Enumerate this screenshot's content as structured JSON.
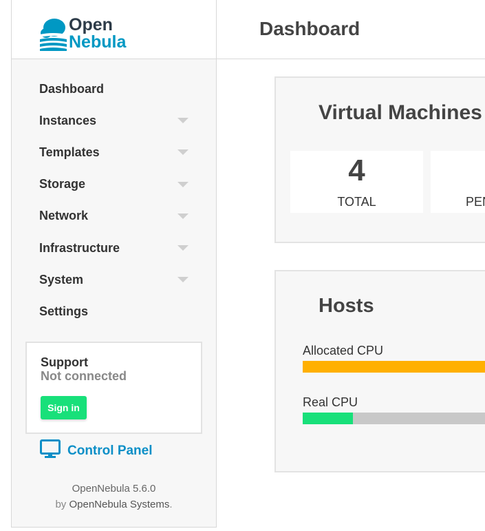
{
  "logo": {
    "line1": "Open",
    "line2": "Nebula"
  },
  "header": {
    "title": "Dashboard"
  },
  "sidebar": {
    "items": [
      {
        "label": "Dashboard",
        "has_submenu": false
      },
      {
        "label": "Instances",
        "has_submenu": true
      },
      {
        "label": "Templates",
        "has_submenu": true
      },
      {
        "label": "Storage",
        "has_submenu": true
      },
      {
        "label": "Network",
        "has_submenu": true
      },
      {
        "label": "Infrastructure",
        "has_submenu": true
      },
      {
        "label": "System",
        "has_submenu": true
      },
      {
        "label": "Settings",
        "has_submenu": false
      }
    ],
    "support": {
      "title": "Support",
      "status": "Not connected",
      "signin_label": "Sign in"
    },
    "control_panel": {
      "label": "Control Panel",
      "icon": "monitor-icon"
    },
    "footer": {
      "version": "OpenNebula 5.6.0",
      "by": "by",
      "company": "OpenNebula Systems",
      "period": "."
    }
  },
  "vm_widget": {
    "title": "Virtual Machines",
    "total": {
      "value": "4",
      "label": "TOTAL"
    },
    "pending": {
      "value": "",
      "label": "PEN"
    }
  },
  "hosts_widget": {
    "title": "Hosts",
    "allocated_cpu": {
      "label": "Allocated CPU",
      "fraction": 1.0,
      "color": "#ffb000"
    },
    "real_cpu": {
      "label": "Real CPU",
      "fraction": 0.25,
      "color": "#18e07a"
    }
  },
  "colors": {
    "accent": "#0098c3",
    "brand_dark": "#2d3b48",
    "success": "#18e07a",
    "warning": "#ffb000",
    "link": "#0c8fc7"
  }
}
